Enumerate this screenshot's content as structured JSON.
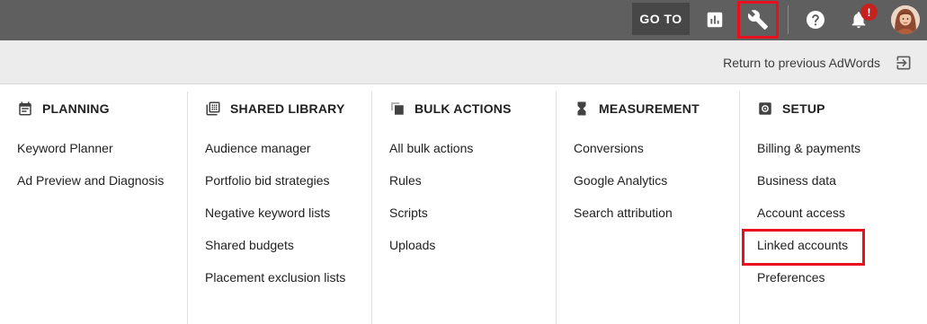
{
  "topbar": {
    "goto_label": "GO TO",
    "badge": "!",
    "icons": [
      "bar-chart-icon",
      "wrench-icon",
      "help-icon",
      "bell-icon"
    ],
    "highlight_color": "#e8101e"
  },
  "subbar": {
    "return_label": "Return to previous AdWords"
  },
  "menu": {
    "columns": [
      {
        "title": "PLANNING",
        "icon": "calendar-icon",
        "items": [
          "Keyword Planner",
          "Ad Preview and Diagnosis"
        ]
      },
      {
        "title": "SHARED LIBRARY",
        "icon": "library-grid-icon",
        "items": [
          "Audience manager",
          "Portfolio bid strategies",
          "Negative keyword lists",
          "Shared budgets",
          "Placement exclusion lists"
        ]
      },
      {
        "title": "BULK ACTIONS",
        "icon": "copy-stack-icon",
        "items": [
          "All bulk actions",
          "Rules",
          "Scripts",
          "Uploads"
        ]
      },
      {
        "title": "MEASUREMENT",
        "icon": "hourglass-icon",
        "items": [
          "Conversions",
          "Google Analytics",
          "Search attribution"
        ]
      },
      {
        "title": "SETUP",
        "icon": "gear-icon",
        "items": [
          "Billing & payments",
          "Business data",
          "Account access",
          "Linked accounts",
          "Preferences"
        ]
      }
    ]
  }
}
